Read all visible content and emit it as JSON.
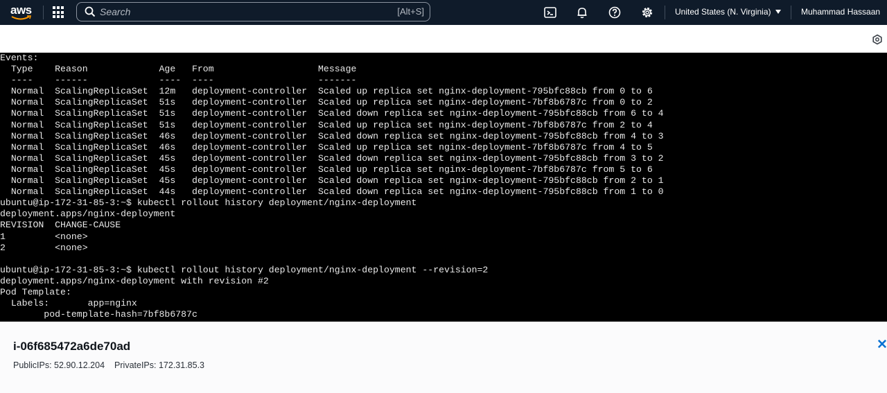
{
  "topbar": {
    "logo_text": "aws",
    "search_placeholder": "Search",
    "search_shortcut": "[Alt+S]",
    "region": "United States (N. Virginia)",
    "user": "Muhammad Hassaan",
    "icons": [
      "cloudshell-icon",
      "bell-icon",
      "help-icon",
      "gear-icon"
    ]
  },
  "terminal": {
    "lines": [
      "Events:",
      "  Type    Reason             Age   From                   Message",
      "  ----    ------             ----  ----                   -------",
      "  Normal  ScalingReplicaSet  12m   deployment-controller  Scaled up replica set nginx-deployment-795bfc88cb from 0 to 6",
      "  Normal  ScalingReplicaSet  51s   deployment-controller  Scaled up replica set nginx-deployment-7bf8b6787c from 0 to 2",
      "  Normal  ScalingReplicaSet  51s   deployment-controller  Scaled down replica set nginx-deployment-795bfc88cb from 6 to 4",
      "  Normal  ScalingReplicaSet  51s   deployment-controller  Scaled up replica set nginx-deployment-7bf8b6787c from 2 to 4",
      "  Normal  ScalingReplicaSet  46s   deployment-controller  Scaled down replica set nginx-deployment-795bfc88cb from 4 to 3",
      "  Normal  ScalingReplicaSet  46s   deployment-controller  Scaled up replica set nginx-deployment-7bf8b6787c from 4 to 5",
      "  Normal  ScalingReplicaSet  45s   deployment-controller  Scaled down replica set nginx-deployment-795bfc88cb from 3 to 2",
      "  Normal  ScalingReplicaSet  45s   deployment-controller  Scaled up replica set nginx-deployment-7bf8b6787c from 5 to 6",
      "  Normal  ScalingReplicaSet  45s   deployment-controller  Scaled down replica set nginx-deployment-795bfc88cb from 2 to 1",
      "  Normal  ScalingReplicaSet  44s   deployment-controller  Scaled down replica set nginx-deployment-795bfc88cb from 1 to 0",
      "ubuntu@ip-172-31-85-3:~$ kubectl rollout history deployment/nginx-deployment",
      "deployment.apps/nginx-deployment",
      "REVISION  CHANGE-CAUSE",
      "1         <none>",
      "2         <none>",
      "",
      "ubuntu@ip-172-31-85-3:~$ kubectl rollout history deployment/nginx-deployment --revision=2",
      "deployment.apps/nginx-deployment with revision #2",
      "Pod Template:",
      "  Labels:       app=nginx",
      "        pod-template-hash=7bf8b6787c"
    ]
  },
  "instance": {
    "id": "i-06f685472a6de70ad",
    "public_ips": "PublicIPs: 52.90.12.204",
    "private_ips": "PrivateIPs: 172.31.85.3",
    "close_label": "✕"
  }
}
